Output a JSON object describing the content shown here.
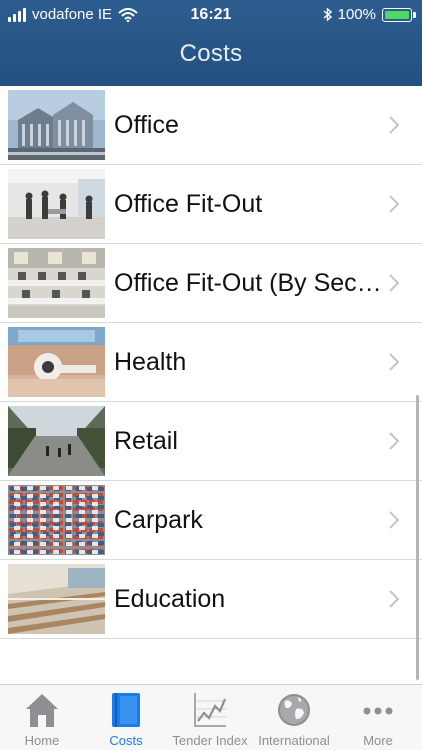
{
  "status_bar": {
    "carrier": "vodafone IE",
    "time": "16:21",
    "battery": "100%"
  },
  "nav": {
    "title": "Costs"
  },
  "list": {
    "items": [
      {
        "label": "Office",
        "icon": "office-building-photo"
      },
      {
        "label": "Office Fit-Out",
        "icon": "office-fitout-photo"
      },
      {
        "label": "Office Fit-Out (By Sector)",
        "icon": "office-fitout-sector-photo"
      },
      {
        "label": "Health",
        "icon": "health-photo"
      },
      {
        "label": "Retail",
        "icon": "retail-photo"
      },
      {
        "label": "Carpark",
        "icon": "carpark-photo"
      },
      {
        "label": "Education",
        "icon": "education-photo"
      }
    ]
  },
  "tabbar": {
    "active": "Costs",
    "tabs": [
      {
        "label": "Home",
        "icon": "home-icon"
      },
      {
        "label": "Costs",
        "icon": "book-icon"
      },
      {
        "label": "Tender Index",
        "icon": "chart-icon"
      },
      {
        "label": "International",
        "icon": "globe-icon"
      },
      {
        "label": "More",
        "icon": "more-icon"
      }
    ]
  },
  "colors": {
    "nav_bar": "#23507f",
    "active_tab": "#1a7ce8",
    "inactive_tab": "#8e8e93",
    "battery": "#4cd964"
  }
}
